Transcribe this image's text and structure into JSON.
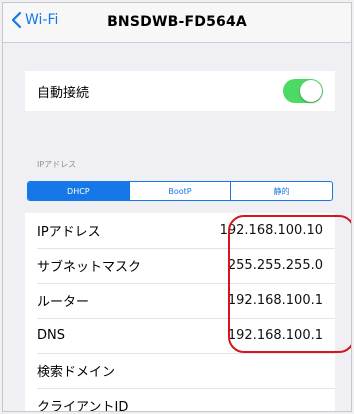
{
  "nav": {
    "back_label": "Wi-Fi",
    "title": "BNSDWB-FD564A"
  },
  "auto_join": {
    "label": "自動接続",
    "enabled": true
  },
  "ip_section": {
    "header": "IPアドレス",
    "segments": [
      "DHCP",
      "BootP",
      "静的"
    ],
    "selected_segment": "DHCP"
  },
  "details": [
    {
      "label": "IPアドレス",
      "value": "192.168.100.10"
    },
    {
      "label": "サブネットマスク",
      "value": "255.255.255.0"
    },
    {
      "label": "ルーター",
      "value": "192.168.100.1"
    },
    {
      "label": "DNS",
      "value": "192.168.100.1"
    },
    {
      "label": "検索ドメイン",
      "value": ""
    },
    {
      "label": "クライアントID",
      "value": ""
    }
  ],
  "colors": {
    "accent": "#1577e8",
    "toggle_on": "#4cd964",
    "highlight": "#d9141e",
    "background": "#efeff4"
  }
}
